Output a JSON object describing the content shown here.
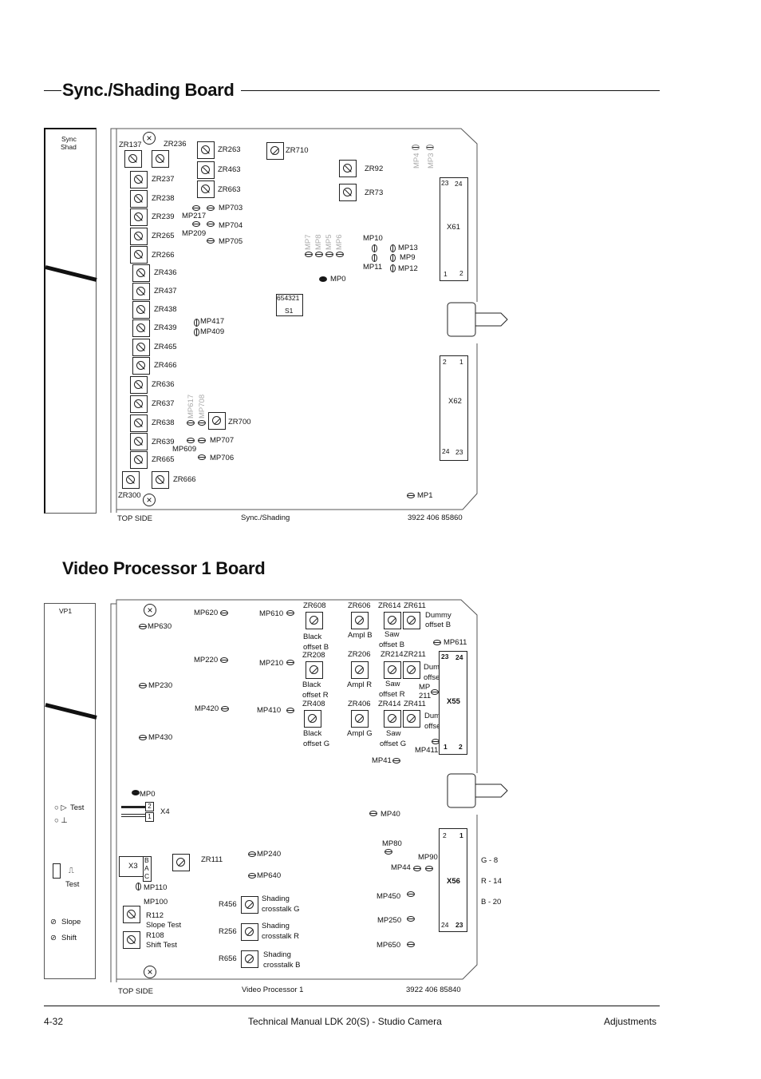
{
  "sync_section": {
    "title": "Sync./Shading Board",
    "side_panel_label": [
      "Sync",
      "Shad"
    ],
    "potentiometers": [
      "ZR137",
      "ZR236",
      "ZR237",
      "ZR238",
      "ZR239",
      "ZR265",
      "ZR266",
      "ZR436",
      "ZR437",
      "ZR438",
      "ZR439",
      "ZR465",
      "ZR466",
      "ZR636",
      "ZR637",
      "ZR638",
      "ZR639",
      "ZR665",
      "ZR300",
      "ZR666",
      "ZR263",
      "ZR463",
      "ZR663",
      "ZR710",
      "ZR92",
      "ZR73",
      "ZR700"
    ],
    "measuring_points": [
      "MP703",
      "MP217",
      "MP704",
      "MP209",
      "MP705",
      "MP4",
      "MP3",
      "MP7",
      "MP8",
      "MP5",
      "MP6",
      "MP10",
      "MP11",
      "MP13",
      "MP9",
      "MP12",
      "MP0",
      "MP417",
      "MP409",
      "MP617",
      "MP708",
      "MP707",
      "MP609",
      "MP706",
      "MP1"
    ],
    "switch": {
      "label": "S1",
      "positions": "654321"
    },
    "connectors": [
      {
        "name": "X61",
        "pins_top": [
          "23",
          "24"
        ],
        "pins_bottom": [
          "1",
          "2"
        ]
      },
      {
        "name": "X62",
        "pins_top": [
          "2",
          "1"
        ],
        "pins_bottom": [
          "24",
          "23"
        ]
      }
    ],
    "footer_left": "TOP SIDE",
    "footer_center": "Sync./Shading",
    "footer_right": "3922 406 85860"
  },
  "vp1_section": {
    "title": "Video Processor 1 Board",
    "side_panel_label": "VP1",
    "side_controls": [
      "Test",
      "Test",
      "Slope",
      "Shift"
    ],
    "potentiometers": [
      {
        "ref": "ZR608",
        "desc": [
          "Black",
          "offset B"
        ]
      },
      {
        "ref": "ZR606",
        "desc": [
          "Ampl B"
        ]
      },
      {
        "ref": "ZR614",
        "desc": [
          "Saw",
          "offset B"
        ]
      },
      {
        "ref": "ZR611",
        "desc": [
          "Dummy",
          "offset B"
        ]
      },
      {
        "ref": "ZR208",
        "desc": [
          "Black",
          "offset R"
        ]
      },
      {
        "ref": "ZR206",
        "desc": [
          "Ampl R"
        ]
      },
      {
        "ref": "ZR214",
        "desc": [
          "Saw",
          "offset R"
        ]
      },
      {
        "ref": "ZR211",
        "desc": [
          "Dummy",
          "offset R"
        ]
      },
      {
        "ref": "ZR408",
        "desc": [
          "Black",
          "offset G"
        ]
      },
      {
        "ref": "ZR406",
        "desc": [
          "Ampl G"
        ]
      },
      {
        "ref": "ZR414",
        "desc": [
          "Saw",
          "offset G"
        ]
      },
      {
        "ref": "ZR411",
        "desc": [
          "Dummy",
          "offset G"
        ]
      },
      {
        "ref": "ZR111",
        "desc": []
      },
      {
        "ref": "R456",
        "desc": [
          "Shading",
          "crosstalk G"
        ]
      },
      {
        "ref": "R256",
        "desc": [
          "Shading",
          "crosstalk R"
        ]
      },
      {
        "ref": "R656",
        "desc": [
          "Shading",
          "crosstalk B"
        ]
      },
      {
        "ref": "R112",
        "desc": [
          "Slope Test"
        ]
      },
      {
        "ref": "R108",
        "desc": [
          "Shift Test"
        ]
      }
    ],
    "measuring_points": [
      "MP630",
      "MP620",
      "MP610",
      "MP220",
      "MP210",
      "MP230",
      "MP420",
      "MP410",
      "MP430",
      "MP611",
      "MP 211",
      "MP411",
      "MP41",
      "MP0",
      "MP40",
      "MP80",
      "MP90",
      "MP44",
      "MP240",
      "MP640",
      "MP110",
      "MP100",
      "MP450",
      "MP250",
      "MP650"
    ],
    "connectors": [
      {
        "name": "X55",
        "pins_top": [
          "23",
          "24"
        ],
        "pins_bottom": [
          "1",
          "2"
        ]
      },
      {
        "name": "X56",
        "pins_top": [
          "2",
          "1"
        ],
        "pins_bottom": [
          "24",
          "23"
        ]
      },
      {
        "name": "X4",
        "pins": [
          "2",
          "1"
        ]
      },
      {
        "name": "X3",
        "pins": [
          "B",
          "A",
          "C"
        ]
      }
    ],
    "pin_legend": [
      "G - 8",
      "R - 14",
      "B - 20"
    ],
    "footer_left": "TOP SIDE",
    "footer_center": "Video Processor 1",
    "footer_right": "3922 406 85840"
  },
  "page_footer": {
    "page_number": "4-32",
    "manual_title": "Technical Manual LDK 20(S) - Studio Camera",
    "chapter": "Adjustments"
  }
}
